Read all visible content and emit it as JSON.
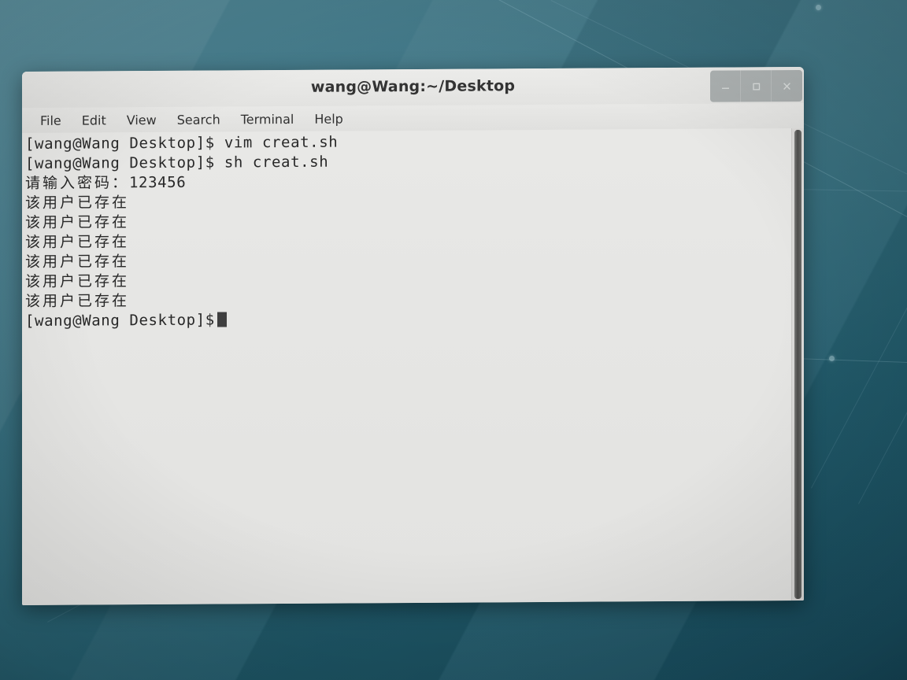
{
  "desktop": {
    "wallpaper_color": "#2f6878",
    "wallpaper_accent": "#4e8594"
  },
  "window": {
    "title": "wang@Wang:~/Desktop",
    "controls": [
      {
        "name": "minimize",
        "glyph": "minimize-icon",
        "label": "–"
      },
      {
        "name": "maximize",
        "glyph": "maximize-icon",
        "label": "□"
      },
      {
        "name": "close",
        "glyph": "close-icon",
        "label": "✕"
      }
    ],
    "menu": [
      {
        "label": "File"
      },
      {
        "label": "Edit"
      },
      {
        "label": "View"
      },
      {
        "label": "Search"
      },
      {
        "label": "Terminal"
      },
      {
        "label": "Help"
      }
    ]
  },
  "terminal": {
    "background_color": "#e9e9e7",
    "text_color": "#262626",
    "prompt": "[wang@Wang Desktop]$",
    "lines": [
      {
        "type": "prompt",
        "prompt": "[wang@Wang Desktop]$",
        "command": " vim creat.sh"
      },
      {
        "type": "prompt",
        "prompt": "[wang@Wang Desktop]$",
        "command": " sh creat.sh"
      },
      {
        "type": "output",
        "cjk": "请输入密码：",
        "ascii": "123456"
      },
      {
        "type": "output",
        "cjk": "该用户已存在",
        "ascii": ""
      },
      {
        "type": "output",
        "cjk": "该用户已存在",
        "ascii": ""
      },
      {
        "type": "output",
        "cjk": "该用户已存在",
        "ascii": ""
      },
      {
        "type": "output",
        "cjk": "该用户已存在",
        "ascii": ""
      },
      {
        "type": "output",
        "cjk": "该用户已存在",
        "ascii": ""
      },
      {
        "type": "output",
        "cjk": "该用户已存在",
        "ascii": ""
      },
      {
        "type": "cursor",
        "prompt": "[wang@Wang Desktop]$",
        "command": ""
      }
    ]
  }
}
